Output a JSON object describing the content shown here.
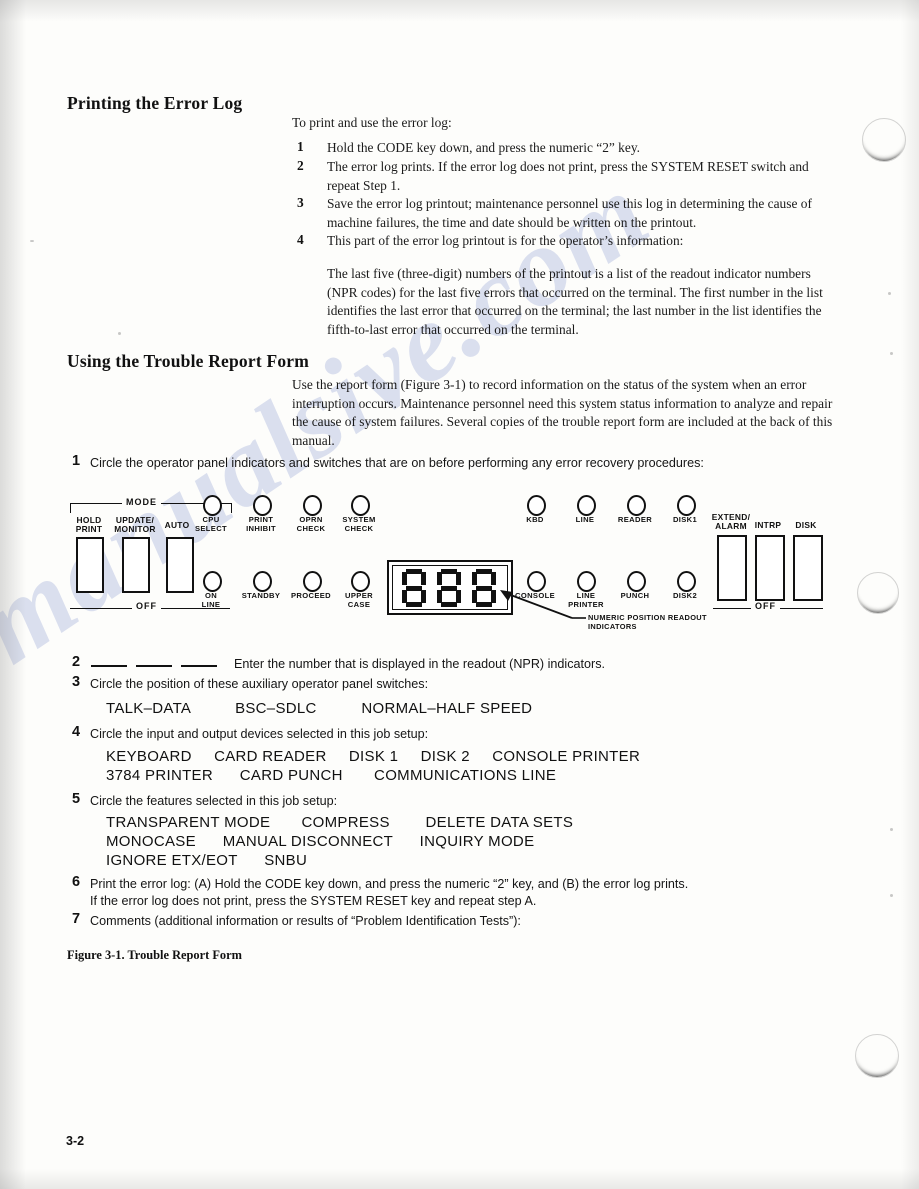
{
  "page": {
    "folio": "3-2",
    "watermark": "manualsive.com"
  },
  "section1": {
    "heading": "Printing the Error Log",
    "intro": "To print and use the error log:",
    "steps": [
      {
        "n": "1",
        "text": "Hold the CODE key down, and press the numeric “2” key."
      },
      {
        "n": "2",
        "text": "The error log prints.  If the error log does not print, press the SYSTEM RESET switch and repeat Step 1."
      },
      {
        "n": "3",
        "text": "Save the error log printout; maintenance personnel use this log in determining the cause of machine failures, the time and date should be written on the printout."
      },
      {
        "n": "4",
        "text": "This part of the error log printout is for the operator’s information:"
      }
    ],
    "note": "The last five (three-digit) numbers of the printout is a list of the readout indicator numbers (NPR codes) for the last five errors that occurred on the terminal.  The first number in the list identifies the last error that occurred on the terminal; the last number in the list identifies the fifth-to-last error that occurred on the terminal."
  },
  "section2": {
    "heading": "Using the Trouble Report Form",
    "intro": "Use the report form (Figure 3-1) to record information on the status of the system when an error interruption occurs.  Maintenance personnel need this system status information to analyze and repair the cause of system failures.  Several copies of the trouble report form are included at the back of this manual."
  },
  "form": {
    "item1": {
      "n": "1",
      "text": "Circle the operator panel indicators and switches that are on before performing any error recovery procedures:"
    },
    "item2": {
      "n": "2",
      "text": "Enter the number that is displayed in the readout (NPR) indicators."
    },
    "item3": {
      "n": "3",
      "text": "Circle the position of these auxiliary operator panel switches:",
      "options": "TALK–DATA          BSC–SDLC          NORMAL–HALF SPEED"
    },
    "item4": {
      "n": "4",
      "text": "Circle the input and output devices selected in this job setup:",
      "options_line1": "KEYBOARD     CARD READER     DISK 1     DISK 2     CONSOLE PRINTER",
      "options_line2": "3784 PRINTER      CARD PUNCH       COMMUNICATIONS LINE"
    },
    "item5": {
      "n": "5",
      "text": "Circle the features selected in this job setup:",
      "options_line1": "TRANSPARENT MODE       COMPRESS        DELETE DATA SETS",
      "options_line2": "MONOCASE      MANUAL DISCONNECT      INQUIRY MODE",
      "options_line3": "IGNORE ETX/EOT      SNBU"
    },
    "item6": {
      "n": "6",
      "line1": "Print the error log:  (A) Hold the CODE key down, and press the numeric “2” key, and (B) the error log prints.",
      "line2": "If the error log does not print, press the SYSTEM RESET key and repeat step A."
    },
    "item7": {
      "n": "7",
      "text": "Comments (additional information or results of “Problem Identification Tests”):"
    },
    "caption": "Figure 3-1.  Trouble Report Form"
  },
  "panel": {
    "mode_bracket_label": "MODE",
    "mode_off_label": "OFF",
    "right_off_label": "OFF",
    "mode_switches": [
      {
        "label": "HOLD\nPRINT"
      },
      {
        "label": "UPDATE/\nMONITOR"
      },
      {
        "label": "AUTO"
      }
    ],
    "right_switches": [
      {
        "label": "EXTEND/\nALARM"
      },
      {
        "label": "INTRP"
      },
      {
        "label": "DISK"
      }
    ],
    "lamps_row1_left": [
      {
        "label": "CPU\nSELECT"
      },
      {
        "label": "PRINT\nINHIBIT"
      },
      {
        "label": "OPRN\nCHECK"
      },
      {
        "label": "SYSTEM\nCHECK"
      }
    ],
    "lamps_row2_left": [
      {
        "label": "ON\nLINE"
      },
      {
        "label": "STANDBY"
      },
      {
        "label": "PROCEED"
      },
      {
        "label": "UPPER\nCASE"
      }
    ],
    "lamps_row1_right": [
      {
        "label": "KBD"
      },
      {
        "label": "LINE"
      },
      {
        "label": "READER"
      },
      {
        "label": "DISK1"
      }
    ],
    "lamps_row2_right": [
      {
        "label": "CONSOLE"
      },
      {
        "label": "LINE\nPRINTER"
      },
      {
        "label": "PUNCH"
      },
      {
        "label": "DISK2"
      }
    ],
    "readout": {
      "digits": "888",
      "callout": "NUMERIC POSITION READOUT\nINDICATORS"
    }
  }
}
